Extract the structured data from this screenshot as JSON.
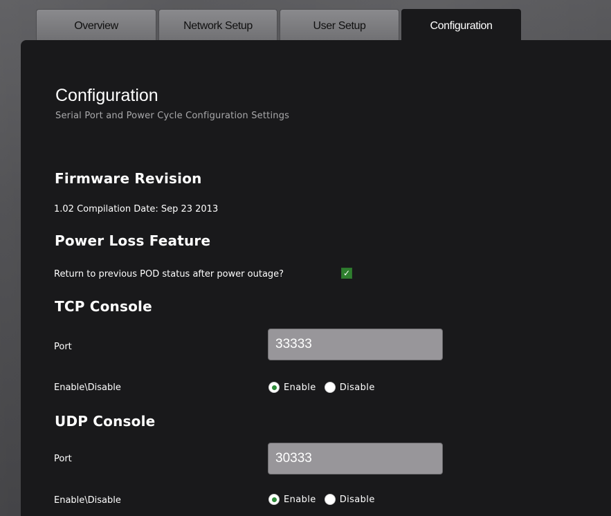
{
  "tabs": [
    {
      "label": "Overview",
      "active": false
    },
    {
      "label": "Network Setup",
      "active": false
    },
    {
      "label": "User Setup",
      "active": false
    },
    {
      "label": "Configuration",
      "active": true
    }
  ],
  "page": {
    "title": "Configuration",
    "subtitle": "Serial Port and Power Cycle Configuration Settings"
  },
  "firmware": {
    "heading": "Firmware Revision",
    "text": "1.02 Compilation Date: Sep 23 2013"
  },
  "power_loss": {
    "heading": "Power Loss Feature",
    "question": "Return to previous POD status after power outage?",
    "checked": true
  },
  "tcp": {
    "heading": "TCP Console",
    "port_label": "Port",
    "port_value": "33333",
    "enable_label": "Enable\\Disable",
    "enable_option": "Enable",
    "disable_option": "Disable",
    "selected": "Enable"
  },
  "udp": {
    "heading": "UDP Console",
    "port_label": "Port",
    "port_value": "30333",
    "enable_label": "Enable\\Disable",
    "enable_option": "Enable",
    "disable_option": "Disable",
    "selected": "Enable"
  },
  "colors": {
    "panel": "#19191b",
    "tab_inactive": "#7d7d80",
    "field_bg": "#98969a",
    "accent_green": "#2e8b3a"
  }
}
